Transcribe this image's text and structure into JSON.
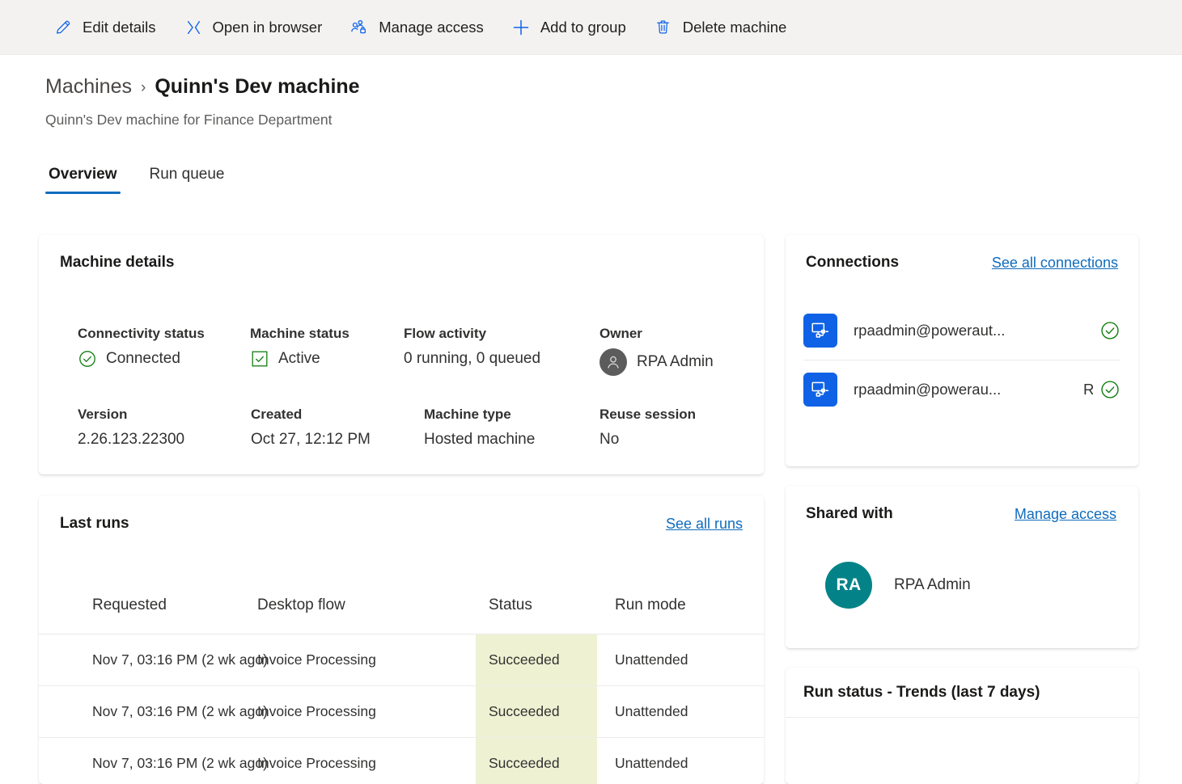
{
  "commandbar": {
    "buttons": [
      {
        "label": "Edit details",
        "icon": "pencil-icon"
      },
      {
        "label": "Open in browser",
        "icon": "open-in-browser-icon"
      },
      {
        "label": "Manage access",
        "icon": "manage-access-icon"
      },
      {
        "label": "Add to group",
        "icon": "plus-icon"
      },
      {
        "label": "Delete machine",
        "icon": "trash-icon"
      }
    ]
  },
  "header": {
    "breadcrumb_parent": "Machines",
    "breadcrumb_separator": "›",
    "title": "Quinn's Dev machine",
    "subtitle": "Quinn's Dev machine for Finance Department"
  },
  "tabs": [
    {
      "label": "Overview",
      "active": true
    },
    {
      "label": "Run queue",
      "active": false
    }
  ],
  "machine_details": {
    "title": "Machine details",
    "fields": [
      {
        "label": "Connectivity status",
        "value": "Connected",
        "icon": "check-circle-icon"
      },
      {
        "label": "Machine status",
        "value": "Active",
        "icon": "check-square-icon"
      },
      {
        "label": "Flow activity",
        "value": "0 running, 0 queued",
        "icon": ""
      },
      {
        "label": "Owner",
        "value": "RPA Admin",
        "icon": "person-avatar-icon"
      },
      {
        "label": "Version",
        "value": "2.26.123.22300",
        "icon": ""
      },
      {
        "label": "Created",
        "value": "Oct 27, 12:12 PM",
        "icon": ""
      },
      {
        "label": "Machine type",
        "value": "Hosted machine",
        "icon": ""
      },
      {
        "label": "Reuse session",
        "value": "No",
        "icon": ""
      }
    ]
  },
  "last_runs": {
    "title": "Last runs",
    "link": "See all runs",
    "columns": [
      "Requested",
      "Desktop flow",
      "Status",
      "Run mode"
    ],
    "rows": [
      {
        "requested": "Nov 7, 03:16 PM (2 wk ago)",
        "flow": "Invoice Processing",
        "status": "Succeeded",
        "mode": "Unattended"
      },
      {
        "requested": "Nov 7, 03:16 PM (2 wk ago)",
        "flow": "Invoice Processing",
        "status": "Succeeded",
        "mode": "Unattended"
      },
      {
        "requested": "Nov 7, 03:16 PM (2 wk ago)",
        "flow": "Invoice Processing",
        "status": "Succeeded",
        "mode": "Unattended"
      }
    ]
  },
  "connections": {
    "title": "Connections",
    "link": "See all connections",
    "items": [
      {
        "name": "rpaadmin@poweraut...",
        "extra": "",
        "icon": "desktop-flow-icon",
        "status_icon": "check-circle-icon"
      },
      {
        "name": "rpaadmin@powerau...",
        "extra": "RPA Admin",
        "icon": "desktop-flow-icon",
        "status_icon": "check-circle-icon"
      }
    ]
  },
  "shared_with": {
    "title": "Shared with",
    "link": "Manage access",
    "people": [
      {
        "initials": "RA",
        "name": "RPA Admin"
      }
    ]
  },
  "trends": {
    "title": "Run status - Trends (last 7 days)"
  },
  "colors": {
    "accent": "#0f6cbd",
    "toolbar_bg": "#f3f2f1",
    "success_green": "#107c10",
    "status_cell_bg": "#eef2d3",
    "avatar_teal": "#038387",
    "connection_blue": "#0f62e6"
  }
}
